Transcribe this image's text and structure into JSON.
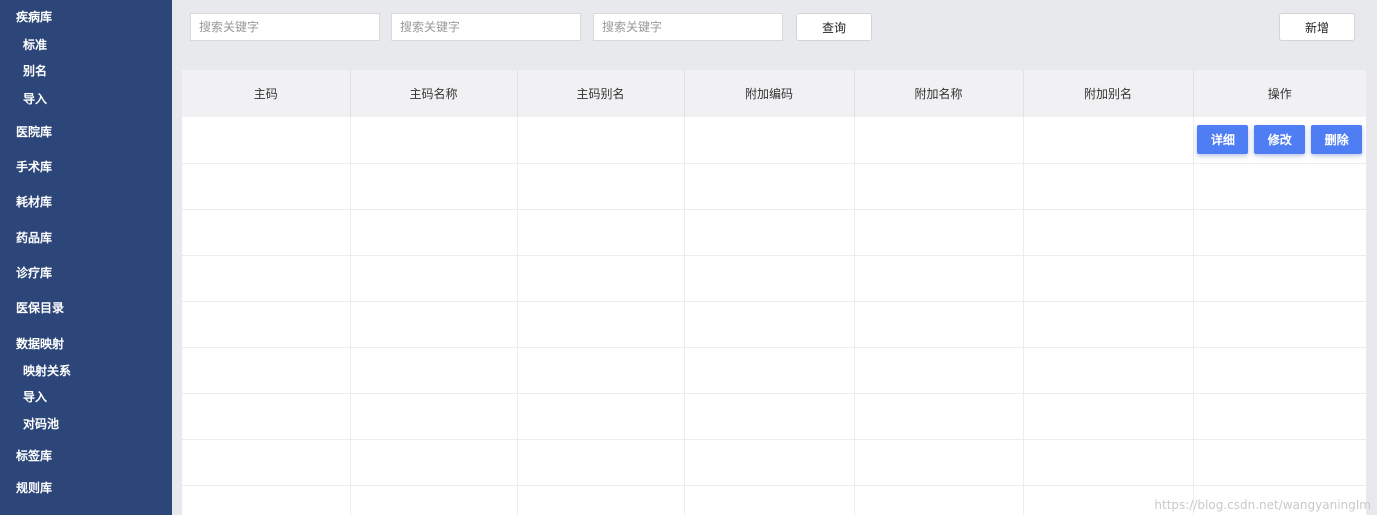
{
  "sidebar": {
    "items": [
      {
        "label": "疾病库",
        "level": 1
      },
      {
        "label": "标准",
        "level": 2
      },
      {
        "label": "别名",
        "level": 2
      },
      {
        "label": "导入",
        "level": 2
      },
      {
        "label": "医院库",
        "level": 1
      },
      {
        "label": "手术库",
        "level": 1
      },
      {
        "label": "耗材库",
        "level": 1
      },
      {
        "label": "药品库",
        "level": 1
      },
      {
        "label": "诊疗库",
        "level": 1
      },
      {
        "label": "医保目录",
        "level": 1
      },
      {
        "label": "数据映射",
        "level": 1
      },
      {
        "label": "映射关系",
        "level": 2
      },
      {
        "label": "导入",
        "level": 2
      },
      {
        "label": "对码池",
        "level": 2
      },
      {
        "label": "标签库",
        "level": 1
      },
      {
        "label": "规则库",
        "level": 1
      }
    ]
  },
  "toolbar": {
    "search_placeholder_1": "搜索关键字",
    "search_placeholder_2": "搜索关键字",
    "search_placeholder_3": "搜索关键字",
    "query_label": "查询",
    "add_label": "新增"
  },
  "table": {
    "columns": [
      "主码",
      "主码名称",
      "主码别名",
      "附加编码",
      "附加名称",
      "附加别名",
      "操作"
    ],
    "row_count": 9,
    "row_actions": {
      "detail": "详细",
      "edit": "修改",
      "delete": "删除"
    }
  },
  "watermark": "https://blog.csdn.net/wangyaningIm",
  "colors": {
    "sidebar_bg": "#2c4679",
    "accent": "#4f7df3",
    "page_bg": "#e8e9ed"
  }
}
